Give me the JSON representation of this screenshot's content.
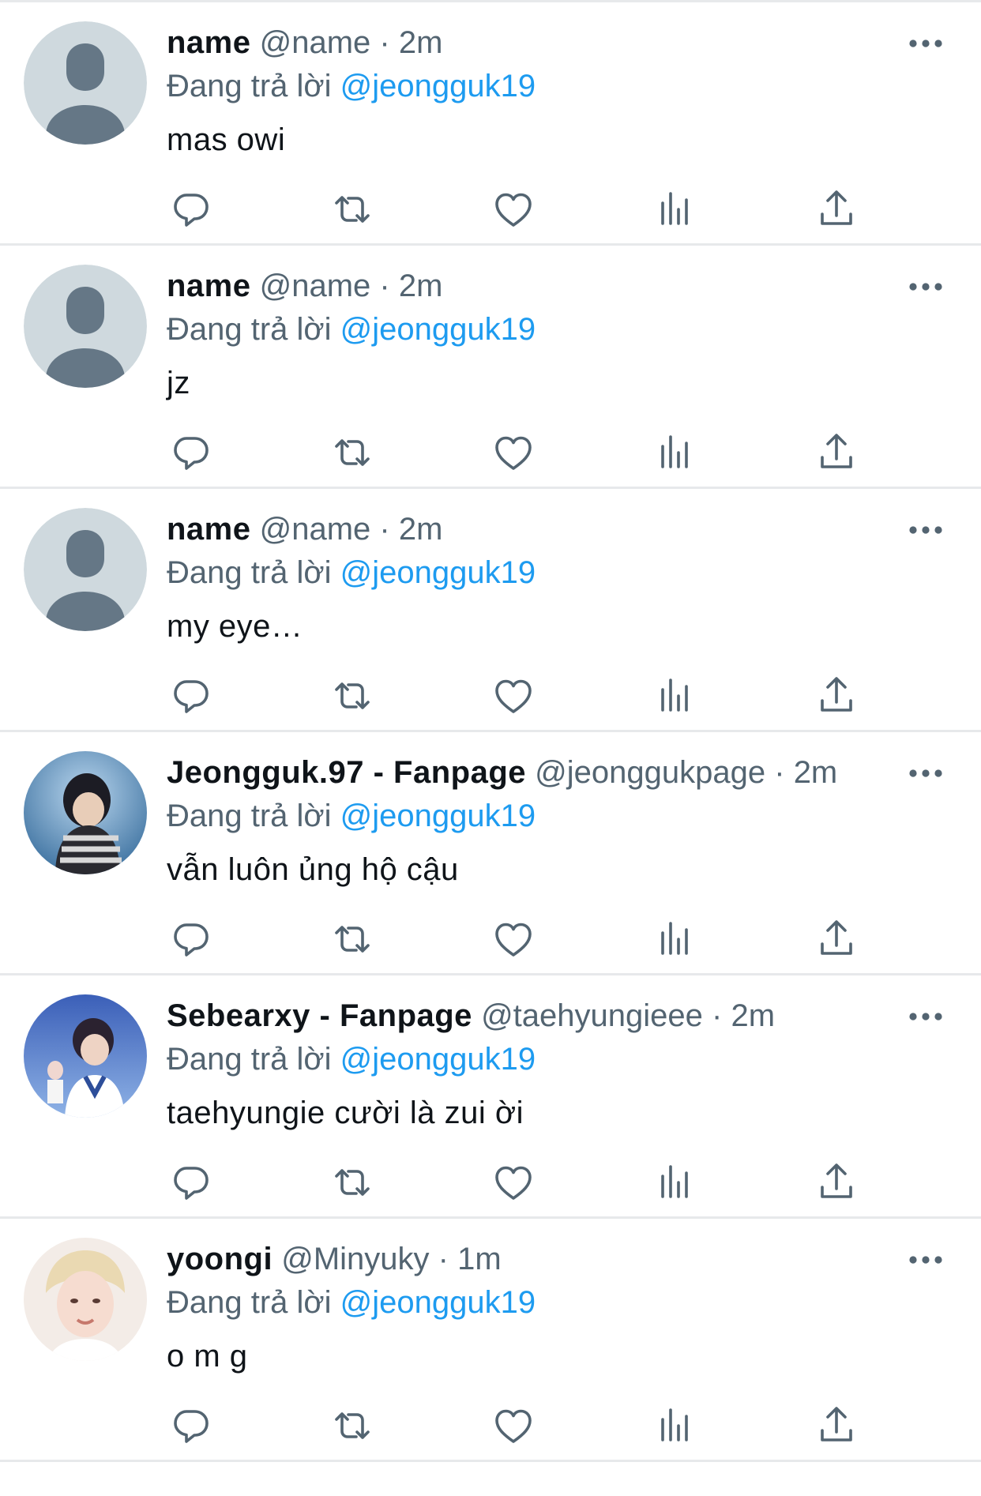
{
  "reply_prefix": "Đang trả lời",
  "reply_to": "@jeongguk19",
  "separator": "·",
  "colors": {
    "text": "#0f1419",
    "secondary": "#536471",
    "link": "#1d9bf0",
    "divider": "#e7e9eb",
    "default_avatar_bg": "#cfd9de",
    "default_avatar_fg": "#657786"
  },
  "icons": {
    "reply": "reply-icon",
    "retweet": "retweet-icon",
    "like": "heart-icon",
    "views": "views-icon",
    "share": "share-icon",
    "more": "more-icon"
  },
  "tweets": [
    {
      "name": "name",
      "handle": "@name",
      "time": "2m",
      "text": "mas owi",
      "avatar": "default-avatar"
    },
    {
      "name": "name",
      "handle": "@name",
      "time": "2m",
      "text": "jz",
      "avatar": "default-avatar"
    },
    {
      "name": "name",
      "handle": "@name",
      "time": "2m",
      "text": "my eye…",
      "avatar": "default-avatar"
    },
    {
      "name": "Jeongguk.97 - Fanpage",
      "handle": "@jeonggukpage",
      "time": "2m",
      "text": "vẫn luôn ủng hộ cậu",
      "avatar": "photo-avatar"
    },
    {
      "name": "Sebearxy - Fanpage",
      "handle": "@taehyungieee",
      "time": "2m",
      "text": "taehyungie cười là zui ời",
      "avatar": "photo-avatar"
    },
    {
      "name": "yoongi",
      "handle": "@Minyuky",
      "time": "1m",
      "text": "o m g",
      "avatar": "photo-avatar"
    }
  ]
}
